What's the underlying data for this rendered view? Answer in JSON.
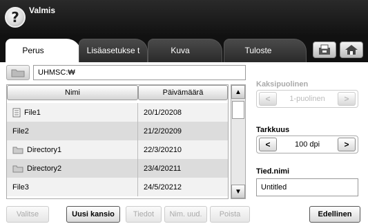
{
  "status": {
    "title": "Valmis"
  },
  "tabs": [
    {
      "label": "Perus"
    },
    {
      "label": "Lisäasetukse t"
    },
    {
      "label": "Kuva"
    },
    {
      "label": "Tuloste"
    }
  ],
  "path": {
    "value": "UHMSC:₩"
  },
  "table": {
    "columns": [
      "Nimi",
      "Päivämäärä"
    ],
    "rows": [
      {
        "name": "File1",
        "date": "20/1/20208",
        "icon": "file-icon"
      },
      {
        "name": "File2",
        "date": "21/2/20209",
        "icon": ""
      },
      {
        "name": "Directory1",
        "date": "22/3/20210",
        "icon": "folder-icon"
      },
      {
        "name": "Directory2",
        "date": "23/4/20211",
        "icon": "folder-icon"
      },
      {
        "name": "File3",
        "date": "24/5/20212",
        "icon": ""
      }
    ]
  },
  "buttons": {
    "select": "Valitse",
    "new_folder": "Uusi kansio",
    "details": "Tiedot",
    "rename": "Nim. uud.",
    "delete": "Poista",
    "back": "Edellinen"
  },
  "duplex": {
    "label": "Kaksipuolinen",
    "value": "1-puolinen"
  },
  "resolution": {
    "label": "Tarkkuus",
    "value": "100 dpi"
  },
  "filename": {
    "label": "Tied.nimi",
    "value": "Untitled"
  }
}
